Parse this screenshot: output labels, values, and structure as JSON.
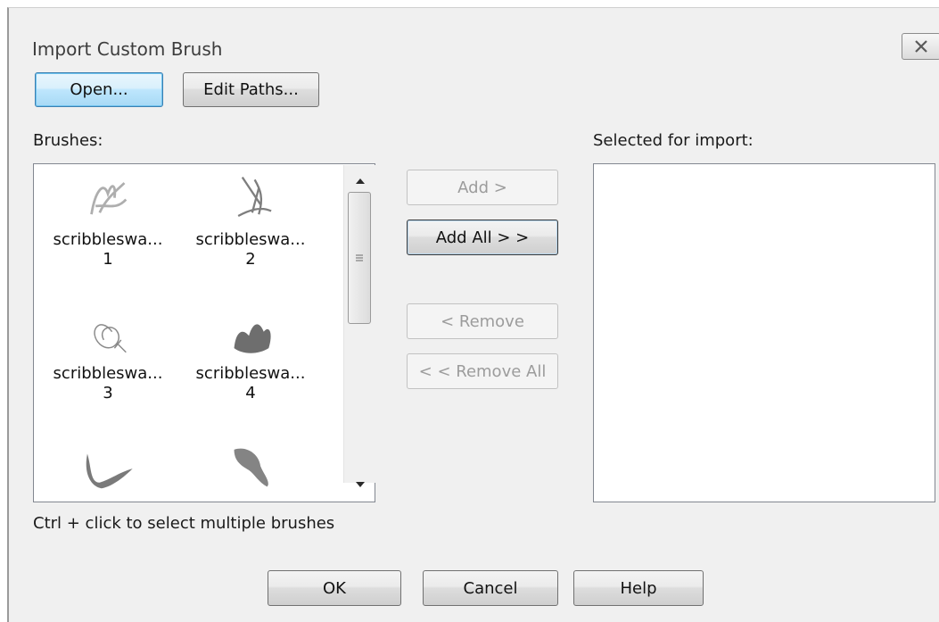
{
  "dialog": {
    "title": "Import Custom Brush",
    "close_icon": "close-icon"
  },
  "toolbar": {
    "open_label": "Open...",
    "edit_paths_label": "Edit Paths..."
  },
  "brushes": {
    "label": "Brushes:",
    "items": [
      {
        "name": "scribbleswa...",
        "number": "1",
        "icon": "scribble-brush-icon"
      },
      {
        "name": "scribbleswa...",
        "number": "2",
        "icon": "scribble-brush-icon"
      },
      {
        "name": "scribbleswa...",
        "number": "3",
        "icon": "scribble-brush-icon"
      },
      {
        "name": "scribbleswa...",
        "number": "4",
        "icon": "scribble-brush-icon"
      },
      {
        "name": "",
        "number": "",
        "icon": "scribble-brush-icon"
      },
      {
        "name": "",
        "number": "",
        "icon": "scribble-brush-icon"
      }
    ],
    "hint": "Ctrl + click to select multiple brushes"
  },
  "actions": {
    "add_label": "Add >",
    "add_all_label": "Add All > >",
    "remove_label": "< Remove",
    "remove_all_label": "< < Remove All"
  },
  "selected": {
    "label": "Selected for import:",
    "items": []
  },
  "footer": {
    "ok_label": "OK",
    "cancel_label": "Cancel",
    "help_label": "Help"
  }
}
